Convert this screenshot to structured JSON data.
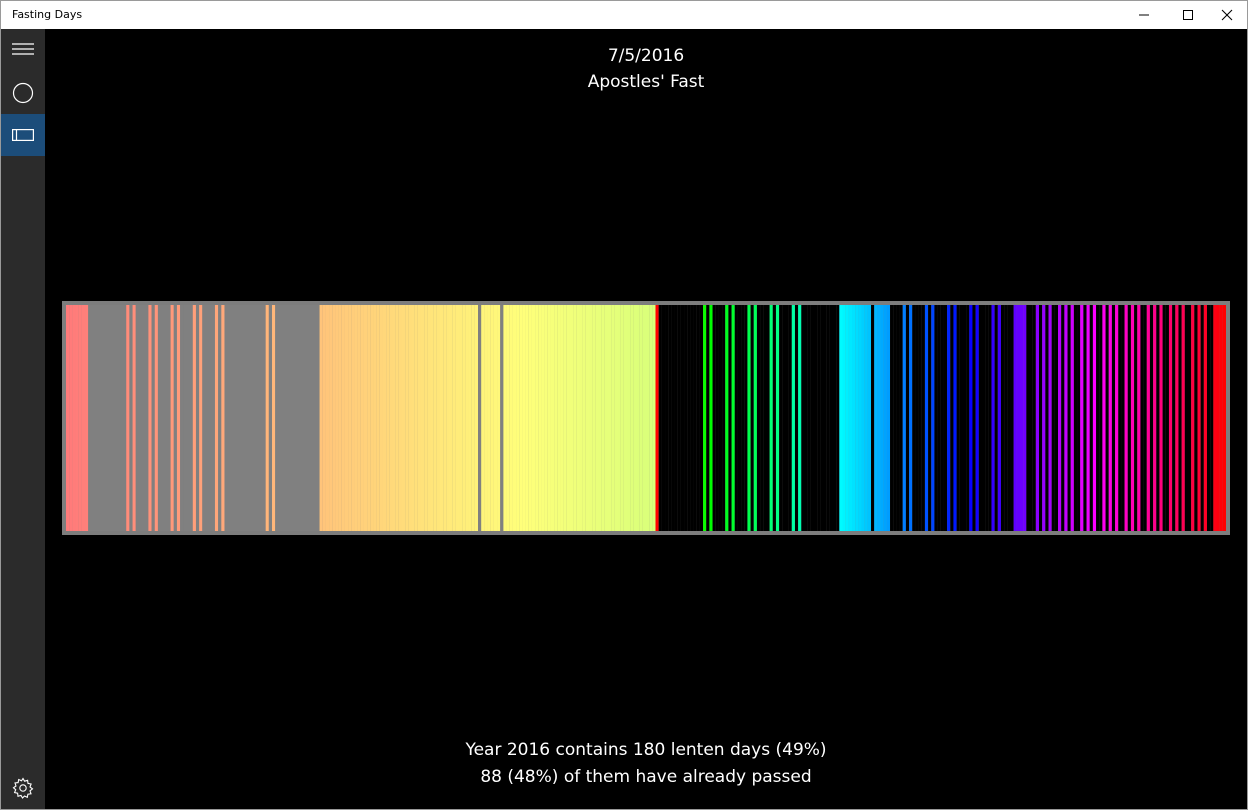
{
  "window": {
    "title": "Fasting Days"
  },
  "titlebar_icons": {
    "minimize": "minimize-icon",
    "maximize": "maximize-icon",
    "close": "close-icon"
  },
  "sidebar": {
    "items": [
      {
        "icon": "hamburger-menu-icon"
      },
      {
        "icon": "circle-icon"
      },
      {
        "icon": "barcode-view-icon",
        "selected": true
      },
      {
        "icon": "gear-icon"
      }
    ]
  },
  "header": {
    "date": "7/5/2016",
    "fast_name": "Apostles' Fast"
  },
  "stats": {
    "line1": "Year 2016 contains 180 lenten days (49%)",
    "line2": "88 (48%) of them have already passed"
  },
  "colors": {
    "background": "#000000",
    "sidebar": "#2b2b2b",
    "sidebar_selected": "#1c4d7a",
    "barcode_frame": "#7d7d7d",
    "passed_nonlenten": "#808080",
    "current_day": "#ff0000"
  },
  "chart_data": {
    "type": "barcode",
    "year": 2016,
    "total_days": 366,
    "lenten_days": 180,
    "lenten_percent": 49,
    "passed_lenten_days": 88,
    "passed_percent": 48,
    "current_date": "7/5/2016",
    "current_day_of_year": 187,
    "lenten_ranges": [
      [
        1,
        7
      ],
      [
        20,
        20
      ],
      [
        22,
        22
      ],
      [
        27,
        27
      ],
      [
        29,
        29
      ],
      [
        34,
        34
      ],
      [
        36,
        36
      ],
      [
        41,
        41
      ],
      [
        43,
        43
      ],
      [
        48,
        48
      ],
      [
        50,
        50
      ],
      [
        64,
        64
      ],
      [
        66,
        66
      ],
      [
        81,
        130
      ],
      [
        132,
        137
      ],
      [
        139,
        187
      ],
      [
        202,
        202
      ],
      [
        204,
        204
      ],
      [
        209,
        209
      ],
      [
        211,
        211
      ],
      [
        216,
        216
      ],
      [
        218,
        218
      ],
      [
        223,
        223
      ],
      [
        225,
        225
      ],
      [
        230,
        230
      ],
      [
        232,
        232
      ],
      [
        245,
        254
      ],
      [
        256,
        260
      ],
      [
        265,
        265
      ],
      [
        267,
        267
      ],
      [
        272,
        272
      ],
      [
        274,
        274
      ],
      [
        279,
        279
      ],
      [
        281,
        281
      ],
      [
        286,
        286
      ],
      [
        288,
        288
      ],
      [
        293,
        293
      ],
      [
        295,
        295
      ],
      [
        300,
        303
      ],
      [
        307,
        307
      ],
      [
        309,
        309
      ],
      [
        311,
        311
      ],
      [
        314,
        314
      ],
      [
        316,
        316
      ],
      [
        318,
        318
      ],
      [
        321,
        321
      ],
      [
        323,
        323
      ],
      [
        325,
        325
      ],
      [
        328,
        328
      ],
      [
        330,
        330
      ],
      [
        332,
        332
      ],
      [
        335,
        335
      ],
      [
        337,
        337
      ],
      [
        339,
        339
      ],
      [
        342,
        342
      ],
      [
        344,
        344
      ],
      [
        346,
        346
      ],
      [
        349,
        349
      ],
      [
        351,
        351
      ],
      [
        353,
        353
      ],
      [
        356,
        356
      ],
      [
        358,
        358
      ],
      [
        360,
        360
      ],
      [
        363,
        366
      ]
    ]
  }
}
